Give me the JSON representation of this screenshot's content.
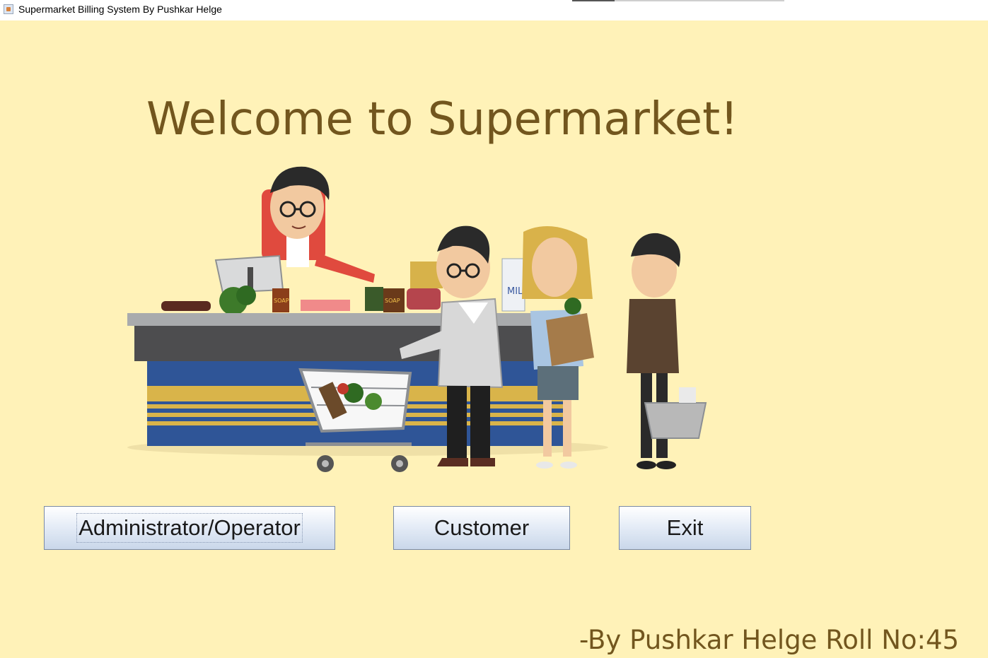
{
  "window": {
    "title": "Supermarket Billing System By Pushkar Helge",
    "icon": "java-app-icon"
  },
  "main": {
    "heading": "Welcome to Supermarket!",
    "illustration": "supermarket-checkout-illustration",
    "illustration_text": {
      "milk": "MILK",
      "soap": "SOAP"
    },
    "footer": "-By Pushkar Helge Roll No:45"
  },
  "buttons": {
    "admin_label": "Administrator/Operator",
    "customer_label": "Customer",
    "exit_label": "Exit"
  },
  "colors": {
    "background": "#fff2b8",
    "heading": "#72561e",
    "button_gradient": [
      "#ffffff",
      "#c9d7ea"
    ]
  }
}
